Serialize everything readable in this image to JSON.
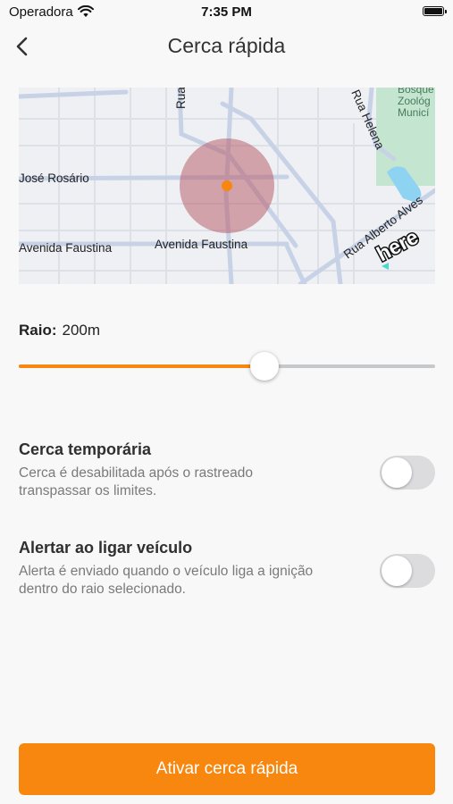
{
  "status_bar": {
    "carrier": "Operadora",
    "time": "7:35 PM"
  },
  "header": {
    "title": "Cerca rápida",
    "back_icon": "chevron-left-icon"
  },
  "map": {
    "streets": [
      "Rua",
      "José Rosário",
      "Avenida Faustina",
      "Avenida Faustina",
      "Rua Alberto Alves",
      "Rua Helena"
    ],
    "poi": [
      "Bosque",
      "Zoológ",
      "Municí"
    ],
    "brand": "here",
    "colors": {
      "radius_fill": "#b5545f",
      "center": "#f7870f",
      "park": "#c4e5cf",
      "water": "#8fd3f3"
    }
  },
  "radius": {
    "label": "Raio:",
    "value_text": "200m",
    "fraction": 0.59
  },
  "settings": [
    {
      "title": "Cerca temporária",
      "desc": "Cerca é desabilitada após o rastreado transpassar os limites.",
      "enabled": false
    },
    {
      "title": "Alertar ao ligar veículo",
      "desc": "Alerta é enviado quando o veículo liga a ignição dentro do raio selecionado.",
      "enabled": false
    }
  ],
  "cta": {
    "label": "Ativar cerca rápida"
  },
  "colors": {
    "accent": "#f7870f",
    "toggle_off": "#dcdcdf"
  }
}
